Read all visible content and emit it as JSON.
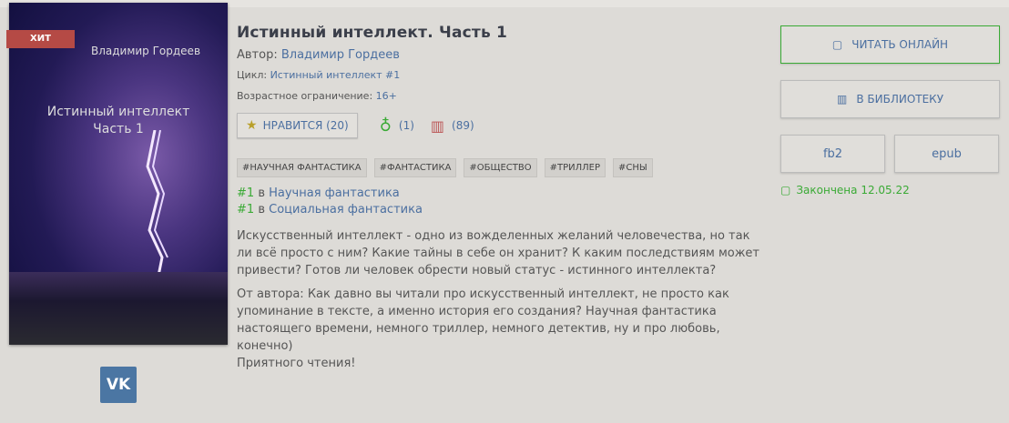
{
  "cover": {
    "badge": "ХИТ",
    "author": "Владимир Гордеев",
    "title_line1": "Истинный интеллект",
    "title_line2": "Часть 1"
  },
  "vk": "VK",
  "book": {
    "title": "Истинный интеллект. Часть 1",
    "author_label": "Автор:",
    "author": "Владимир Гордеев",
    "cycle_label": "Цикл:",
    "cycle": "Истинный интеллект #1",
    "age_label": "Возрастное ограничение:",
    "age": "16+"
  },
  "stats": {
    "like_label": "НРАВИТСЯ (20)",
    "rewards": "(1)",
    "library": "(89)"
  },
  "tags": [
    "#НАУЧНАЯ ФАНТАСТИКА",
    "#ФАНТАСТИКА",
    "#ОБЩЕСТВО",
    "#ТРИЛЛЕР",
    "#СНЫ"
  ],
  "ranks": [
    {
      "num": "#1",
      "in": "в",
      "genre": "Научная фантастика"
    },
    {
      "num": "#1",
      "in": "в",
      "genre": "Социальная фантастика"
    }
  ],
  "description": [
    "Искусственный интеллект - одно из вожделенных желаний человечества, но так ли всё просто с ним? Какие тайны в себе он хранит? К каким последствиям может привести? Готов ли человек обрести новый статус - истинного интеллекта?",
    "От автора: Как давно вы читали про искусственный интеллект, не просто как упоминание в тексте, а именно история его создания? Научная фантастика настоящего времени, немного триллер, немного детектив, ну и про любовь, конечно)",
    "Приятного чтения!"
  ],
  "actions": {
    "read": "ЧИТАТЬ ОНЛАЙН",
    "library": "В БИБЛИОТЕКУ",
    "fb2": "fb2",
    "epub": "epub",
    "status": "Закончена 12.05.22"
  }
}
